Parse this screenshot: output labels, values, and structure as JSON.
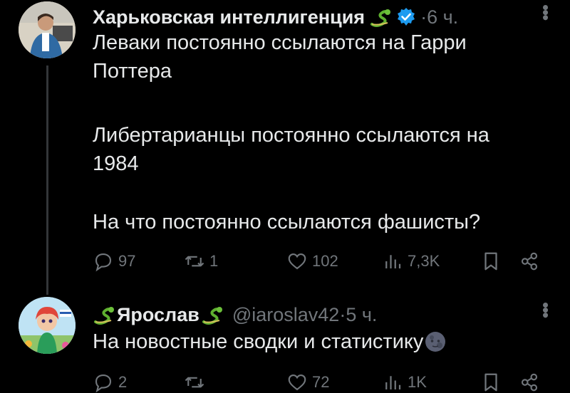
{
  "tweet": {
    "author": "Харьковская интеллигенция",
    "time_sep": " · ",
    "time": "6 ч.",
    "lines": [
      "Леваки постоянно ссылаются на Гарри",
      "Поттера",
      "Либертарианцы постоянно ссылаются на",
      "1984",
      "На что постоянно ссылаются фашисты?"
    ],
    "replies": "97",
    "reposts": "1",
    "likes": "102",
    "views": "7,3K",
    "icons": {
      "reply": "reply-icon",
      "repost": "repost-icon",
      "like": "heart-icon",
      "views": "views-icon",
      "bookmark": "bookmark-icon",
      "share": "share-icon",
      "verified": "verified-badge-icon",
      "snake": "snake-emoji-icon",
      "more": "more-icon"
    }
  },
  "reply": {
    "author": "Ярослав",
    "handle": "@iaroslav42",
    "time_sep": " · ",
    "time": "5 ч.",
    "text": "На новостные сводки и статистику",
    "replies": "2",
    "likes": "72",
    "views": "1K",
    "icons": {
      "moon": "new-moon-face-emoji-icon"
    }
  },
  "colors": {
    "background": "#000000",
    "text": "#e7e9ea",
    "muted": "#71767b",
    "verified": "#1d9bf0",
    "thread": "#333639"
  }
}
